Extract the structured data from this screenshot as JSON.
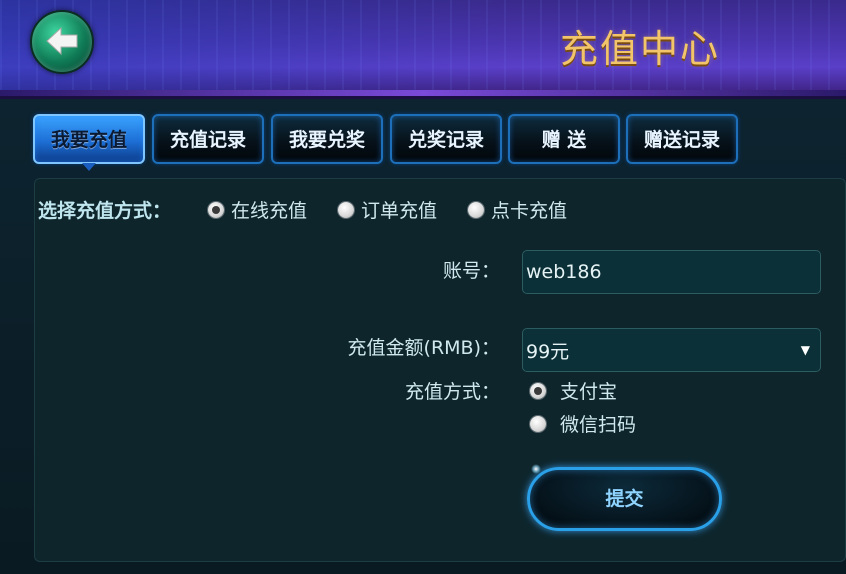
{
  "header": {
    "title": "充值中心"
  },
  "tabs": [
    {
      "label": "我要充值",
      "active": true
    },
    {
      "label": "充值记录",
      "active": false
    },
    {
      "label": "我要兑奖",
      "active": false
    },
    {
      "label": "兑奖记录",
      "active": false
    },
    {
      "label": "赠 送",
      "active": false
    },
    {
      "label": "赠送记录",
      "active": false
    }
  ],
  "method": {
    "label": "选择充值方式：",
    "options": [
      {
        "label": "在线充值",
        "checked": true
      },
      {
        "label": "订单充值",
        "checked": false
      },
      {
        "label": "点卡充值",
        "checked": false
      }
    ]
  },
  "form": {
    "account_label": "账号：",
    "account_value": "web186",
    "amount_label": "充值金额(RMB)：",
    "amount_value": "99元",
    "pay_label": "充值方式：",
    "pay_options": [
      {
        "label": "支付宝",
        "checked": true
      },
      {
        "label": "微信扫码",
        "checked": false
      }
    ],
    "submit_label": "提交"
  },
  "colors": {
    "header_purple": "#4b35b0",
    "title_gold": "#f2c56a",
    "tab_active_blue": "#1d6fd6",
    "panel_teal": "#0e252c"
  },
  "icons": {
    "back": "arrow-left-icon",
    "dropdown": "triangle-down-icon"
  }
}
